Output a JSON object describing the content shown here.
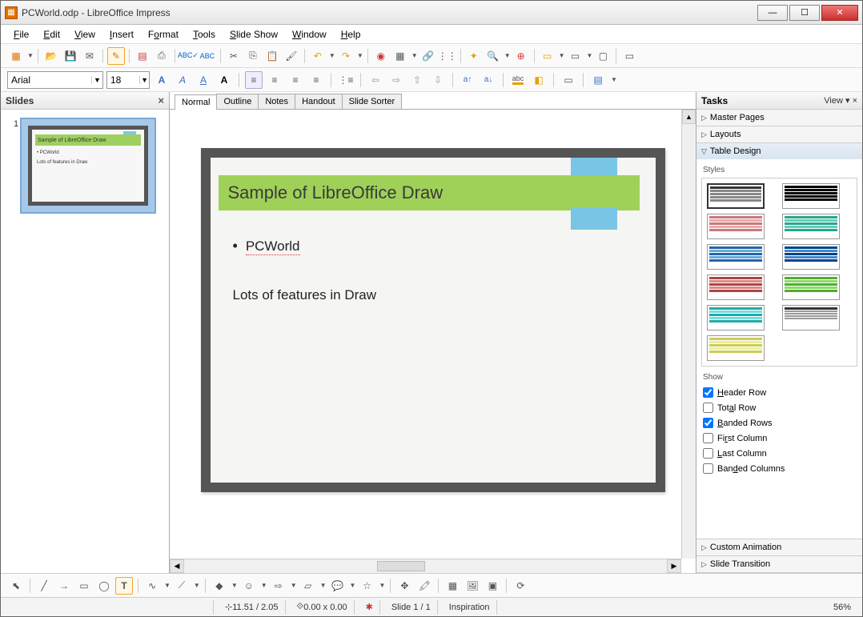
{
  "window": {
    "title": "PCWorld.odp - LibreOffice Impress"
  },
  "menus": [
    "File",
    "Edit",
    "View",
    "Insert",
    "Format",
    "Tools",
    "Slide Show",
    "Window",
    "Help"
  ],
  "font": {
    "name": "Arial",
    "size": "18"
  },
  "view_tabs": [
    "Normal",
    "Outline",
    "Notes",
    "Handout",
    "Slide Sorter"
  ],
  "slides_panel": {
    "title": "Slides",
    "slide_number": "1"
  },
  "slide": {
    "title": "Sample of LibreOffice Draw",
    "bullet1": "PCWorld",
    "line2": "Lots of features in Draw"
  },
  "tasks": {
    "title": "Tasks",
    "view": "View",
    "sections": {
      "master": "Master Pages",
      "layouts": "Layouts",
      "table": "Table Design",
      "custom": "Custom Animation",
      "transition": "Slide Transition"
    },
    "styles_label": "Styles",
    "show_label": "Show",
    "options": {
      "header_row": "Header Row",
      "total_row": "Total Row",
      "banded_rows": "Banded Rows",
      "first_col": "First Column",
      "last_col": "Last Column",
      "banded_cols": "Banded Columns"
    }
  },
  "status": {
    "coords": "11.51 / 2.05",
    "size": "0.00 x 0.00",
    "slide": "Slide 1 / 1",
    "template": "Inspiration",
    "zoom": "56%"
  }
}
